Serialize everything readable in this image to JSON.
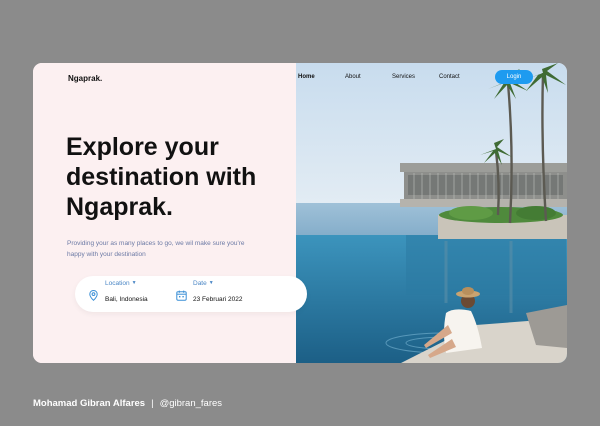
{
  "brand": "Ngaprak.",
  "nav": {
    "items": [
      "Home",
      "About",
      "Services",
      "Contact"
    ],
    "active": "Home",
    "login_label": "Login"
  },
  "hero": {
    "title_lines": [
      "Explore your",
      "destination with",
      "Ngaprak."
    ],
    "subtitle_lines": [
      "Providing your as many places to go, we wil make sure you're",
      "happy with your destination"
    ]
  },
  "search": {
    "location_label": "Location",
    "location_value": "Bali, Indonesia",
    "date_label": "Date",
    "date_value": "23 Februari 2022",
    "location_icon": "map-pin-icon",
    "date_icon": "calendar-icon"
  },
  "credit": {
    "author": "Mohamad Gibran Alfares",
    "separator": "|",
    "handle": "@gibran_fares"
  },
  "colors": {
    "accent": "#1e9bf0",
    "panel_bg": "#fcf0f1",
    "outer_bg": "#8b8b8b",
    "subtitle": "#6c7aa5",
    "label": "#4a86c5"
  }
}
